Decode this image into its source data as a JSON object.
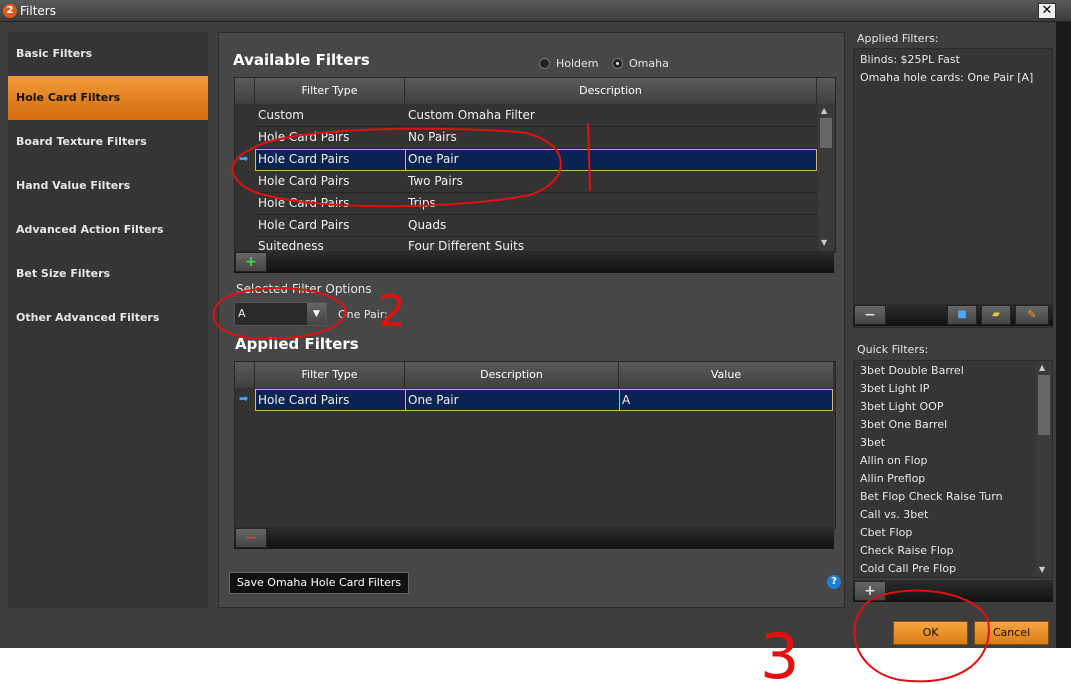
{
  "window": {
    "title": "Filters",
    "logo_text": "2",
    "close_glyph": "✕"
  },
  "sidebar": {
    "items": [
      {
        "label": "Basic Filters",
        "active": false
      },
      {
        "label": "Hole Card Filters",
        "active": true
      },
      {
        "label": "Board Texture Filters",
        "active": false
      },
      {
        "label": "Hand Value Filters",
        "active": false
      },
      {
        "label": "Advanced Action Filters",
        "active": false
      },
      {
        "label": "Bet Size Filters",
        "active": false
      },
      {
        "label": "Other Advanced Filters",
        "active": false
      }
    ]
  },
  "available": {
    "title": "Available Filters",
    "radio": {
      "holdem": "Holdem",
      "omaha": "Omaha",
      "selected": "omaha"
    },
    "columns": [
      "Filter Type",
      "Description"
    ],
    "rows": [
      [
        "Custom",
        "Custom Omaha Filter"
      ],
      [
        "Hole Card Pairs",
        "No Pairs"
      ],
      [
        "Hole Card Pairs",
        "One Pair"
      ],
      [
        "Hole Card Pairs",
        "Two Pairs"
      ],
      [
        "Hole Card Pairs",
        "Trips"
      ],
      [
        "Hole Card Pairs",
        "Quads"
      ],
      [
        "Suitedness",
        "Four Different Suits"
      ]
    ],
    "selected_row": 2,
    "add_glyph": "+"
  },
  "options": {
    "label": "Selected Filter Options",
    "value": "A",
    "value_label": "One Pair:"
  },
  "applied": {
    "title": "Applied Filters",
    "columns": [
      "Filter Type",
      "Description",
      "Value"
    ],
    "rows": [
      [
        "Hole Card Pairs",
        "One Pair",
        "A"
      ]
    ],
    "remove_glyph": "−"
  },
  "save_button": "Save Omaha Hole Card Filters",
  "help_glyph": "?",
  "right_panel": {
    "applied_label": "Applied Filters:",
    "applied_items": [
      "Blinds: $25PL Fast",
      "Omaha hole cards: One Pair [A]"
    ],
    "remove_glyph": "−",
    "quick_label": "Quick Filters:",
    "quick_items": [
      "3bet Double Barrel",
      "3bet Light IP",
      "3bet Light OOP",
      "3bet One Barrel",
      "3bet",
      "Allin on Flop",
      "Allin Preflop",
      "Bet Flop Check Raise Turn",
      "Call vs. 3bet",
      "Cbet Flop",
      "Check Raise Flop",
      "Cold Call Pre Flop"
    ],
    "add_glyph": "+"
  },
  "ok_button": "OK",
  "cancel_button": "Cancel",
  "annotations": [
    "1",
    "2",
    "3"
  ],
  "colors": {
    "accent": "#e8831f",
    "selection": "#0b2350",
    "annotation": "#e01010"
  }
}
